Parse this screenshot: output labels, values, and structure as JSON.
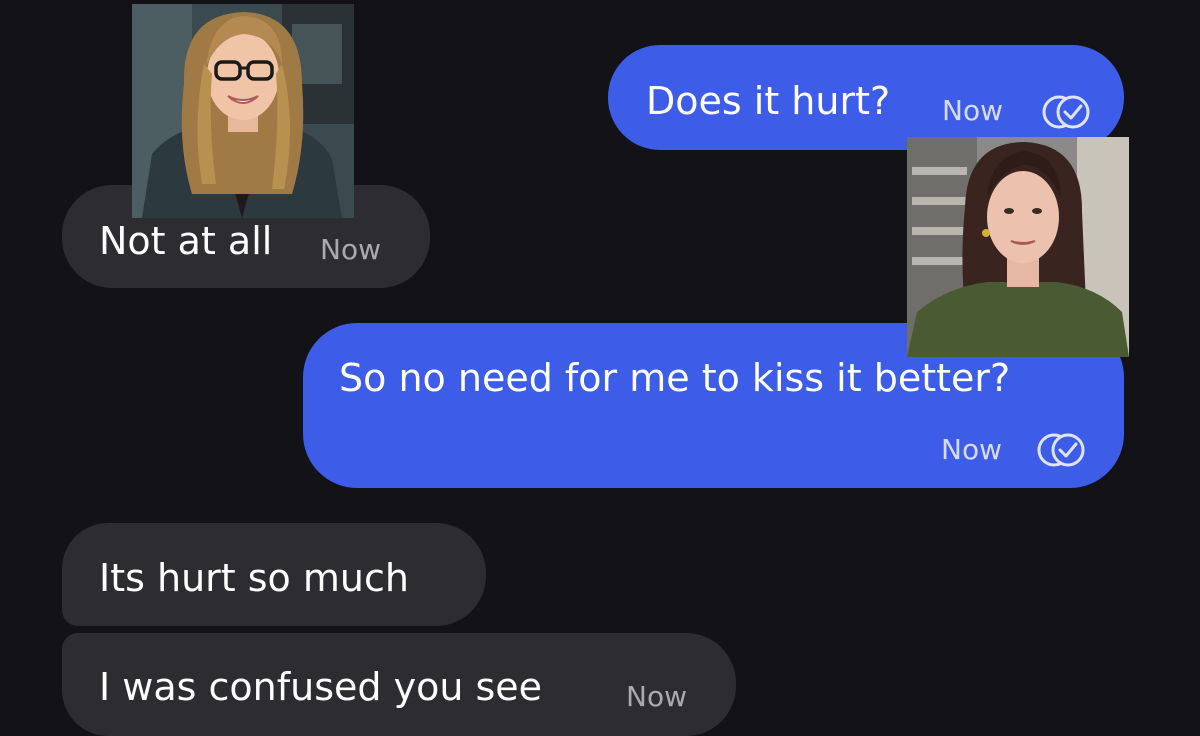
{
  "messages": [
    {
      "id": "b1",
      "direction": "outgoing",
      "text": "Does it hurt?",
      "time": "Now",
      "read_icon": "double-check-icon"
    },
    {
      "id": "b2",
      "direction": "incoming",
      "text": "Not at all",
      "time": "Now"
    },
    {
      "id": "b3",
      "direction": "outgoing",
      "text": "So no need for me to kiss it better?",
      "time": "Now",
      "read_icon": "double-check-icon"
    },
    {
      "id": "b4",
      "direction": "incoming",
      "text": "Its hurt so much"
    },
    {
      "id": "b5",
      "direction": "incoming",
      "text": "I was confused you see",
      "time": "Now"
    }
  ],
  "photos": [
    {
      "name": "photo-blonde-woman-glasses"
    },
    {
      "name": "photo-dark-haired-woman"
    }
  ],
  "colors": {
    "background": "#121217",
    "outgoing_bubble": "#3d5ce8",
    "incoming_bubble": "#2c2c31",
    "text": "#ffffff"
  }
}
